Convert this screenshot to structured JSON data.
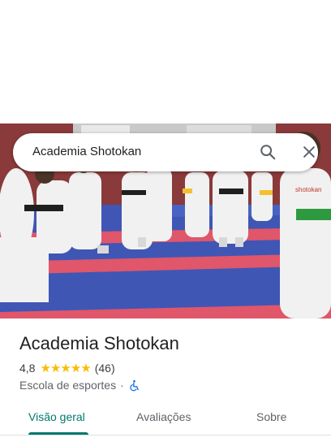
{
  "search": {
    "query": "Academia Shotokan",
    "search_icon": "search-icon",
    "close_icon": "close-icon"
  },
  "photo": {
    "banner_text": "shotokan"
  },
  "place": {
    "name": "Academia Shotokan",
    "rating": "4,8",
    "stars": 5,
    "review_count": "(46)",
    "category": "Escola de esportes",
    "separator": "·",
    "accessibility_icon": "wheelchair-icon"
  },
  "tabs": [
    {
      "label": "Visão geral",
      "active": true
    },
    {
      "label": "Avaliações",
      "active": false
    },
    {
      "label": "Sobre",
      "active": false
    }
  ],
  "colors": {
    "accent": "#00796b",
    "star": "#fbbc04",
    "mat_blue": "#3f56b5",
    "mat_red": "#e0566a"
  }
}
